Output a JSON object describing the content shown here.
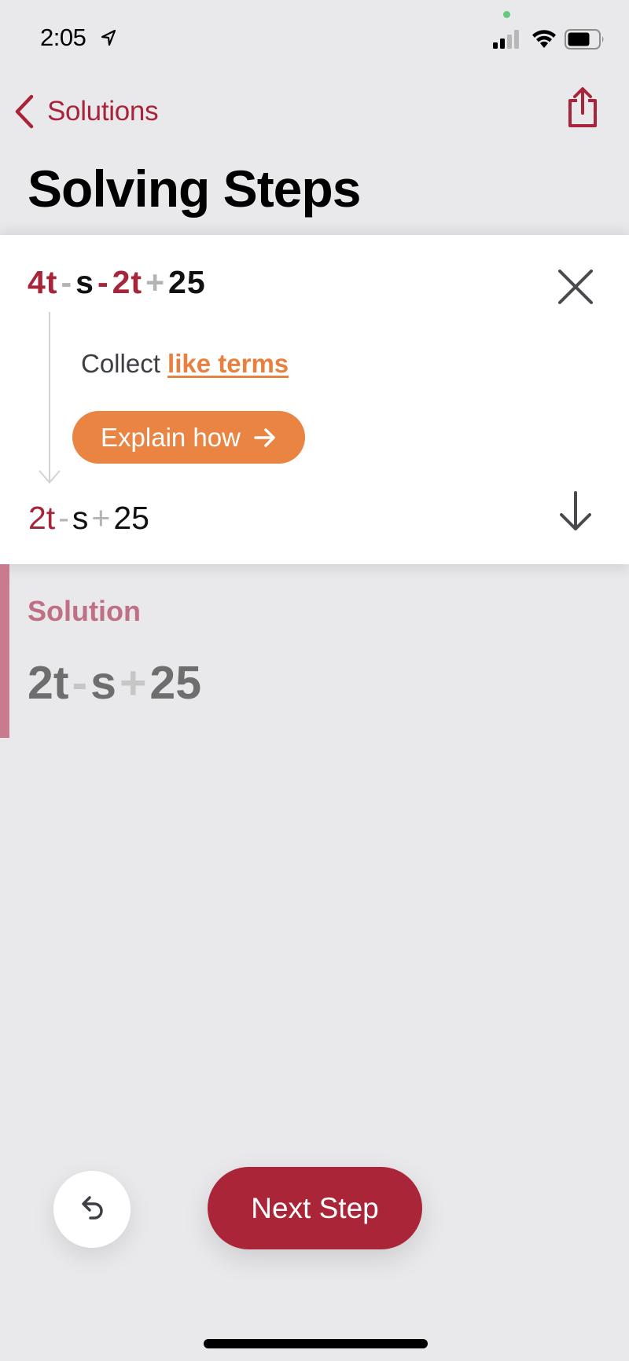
{
  "status_bar": {
    "time": "2:05",
    "location_icon": "location-arrow-icon",
    "signal_icon": "cellular-signal-icon",
    "wifi_icon": "wifi-icon",
    "battery_icon": "battery-icon"
  },
  "nav": {
    "back_label": "Solutions",
    "back_icon": "chevron-left-icon",
    "share_icon": "share-icon"
  },
  "page_title": "Solving Steps",
  "step": {
    "expression_from": [
      {
        "text": "4t",
        "role": "highlight"
      },
      {
        "text": "-",
        "role": "operator"
      },
      {
        "text": "s",
        "role": "term"
      },
      {
        "text": "-",
        "role": "highlight-operator"
      },
      {
        "text": "2t",
        "role": "highlight"
      },
      {
        "text": "+",
        "role": "operator"
      },
      {
        "text": "25",
        "role": "term"
      }
    ],
    "hint_prefix": "Collect",
    "hint_link": "like terms",
    "explain_button": "Explain how",
    "expression_to": [
      {
        "text": "2t",
        "role": "highlight"
      },
      {
        "text": "-",
        "role": "operator"
      },
      {
        "text": "s",
        "role": "term"
      },
      {
        "text": "+",
        "role": "operator"
      },
      {
        "text": "25",
        "role": "term"
      }
    ],
    "close_icon": "close-icon",
    "next_icon": "arrow-down-icon"
  },
  "solution": {
    "label": "Solution",
    "expression": [
      {
        "text": "2t",
        "role": "term"
      },
      {
        "text": "-",
        "role": "operator"
      },
      {
        "text": "s",
        "role": "term"
      },
      {
        "text": "+",
        "role": "operator"
      },
      {
        "text": "25",
        "role": "term"
      }
    ]
  },
  "bottom": {
    "undo_icon": "undo-icon",
    "next_step_label": "Next Step"
  },
  "colors": {
    "accent": "#a8243a",
    "button_red": "#ab2538",
    "explain_orange": "#ea8443",
    "solution_bar": "#c97a8c"
  }
}
